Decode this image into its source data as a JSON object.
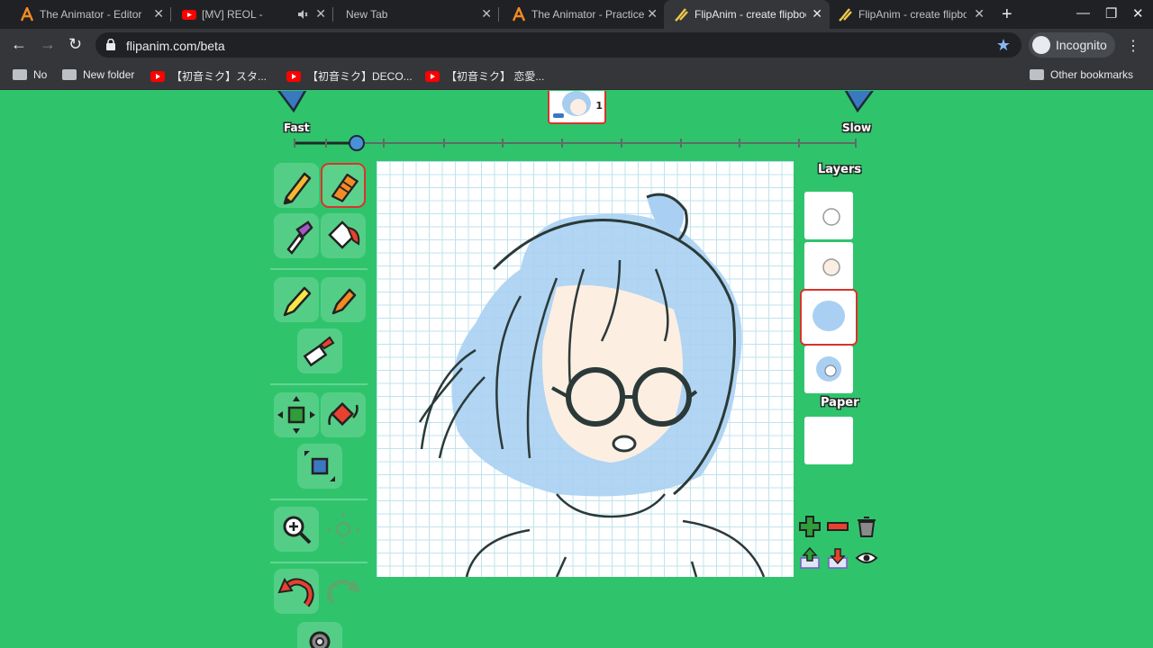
{
  "browser": {
    "tabs": [
      {
        "title": "The Animator - Editor",
        "favicon": "animator-icon",
        "active": false
      },
      {
        "title": "[MV] REOL - No title",
        "favicon": "youtube-icon",
        "active": false,
        "muted": true
      },
      {
        "title": "New Tab",
        "favicon": "",
        "active": false
      },
      {
        "title": "The Animator - Practice",
        "favicon": "animator-icon",
        "active": false
      },
      {
        "title": "FlipAnim - create flipbook",
        "favicon": "flipanim-icon",
        "active": true
      },
      {
        "title": "FlipAnim - create flipbook",
        "favicon": "flipanim-icon",
        "active": false
      }
    ],
    "url": "flipanim.com/beta",
    "incognito_label": "Incognito",
    "bookmarks": [
      {
        "label": "No",
        "type": "folder"
      },
      {
        "label": "New folder",
        "type": "folder"
      },
      {
        "label": "【初音ミク】スタ...",
        "type": "youtube"
      },
      {
        "label": "【初音ミク】DECO...",
        "type": "youtube"
      },
      {
        "label": "【初音ミク】 恋愛...",
        "type": "youtube"
      }
    ],
    "other_bookmarks": "Other bookmarks",
    "accent": "#8ab4f8"
  },
  "app": {
    "speed": {
      "fast_label": "Fast",
      "slow_label": "Slow",
      "value": 0.1
    },
    "frame_number": "1",
    "layers_label": "Layers",
    "paper_label": "Paper",
    "layer_count": 4,
    "selected_layer": 3,
    "colors": {
      "background": "#2fc46c",
      "selection": "#d9332b",
      "grid": "#bfe3ee"
    },
    "tools": [
      "pencil",
      "brush",
      "eyedropper",
      "fill",
      "highlighter",
      "marker",
      "eraser",
      "move",
      "rotate",
      "scale",
      "zoom",
      "pan",
      "undo",
      "redo",
      "settings"
    ],
    "layer_actions": [
      "add-layer",
      "remove-layer",
      "delete-layer",
      "move-layer-up",
      "move-layer-down",
      "toggle-visibility"
    ]
  }
}
